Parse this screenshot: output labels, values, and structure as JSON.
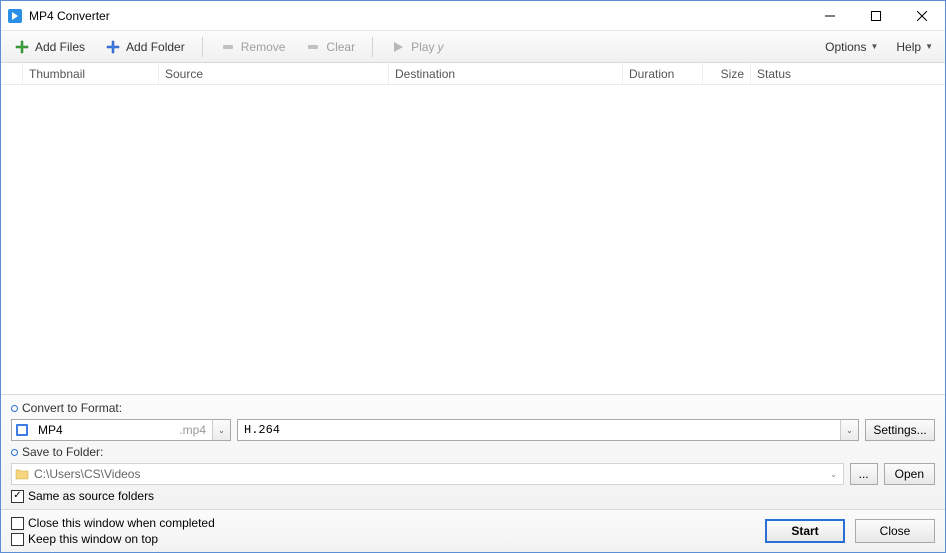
{
  "title": "MP4 Converter",
  "toolbar": {
    "add_files": "Add Files",
    "add_folder": "Add Folder",
    "remove": "Remove",
    "clear": "Clear",
    "play": "Play",
    "play_suffix": "y",
    "options": "Options",
    "help": "Help"
  },
  "columns": {
    "thumbnail": "Thumbnail",
    "source": "Source",
    "destination": "Destination",
    "duration": "Duration",
    "size": "Size",
    "status": "Status"
  },
  "convert": {
    "label": "Convert to Format:",
    "format": "MP4",
    "ext": ".mp4",
    "codec": "H.264",
    "settings": "Settings..."
  },
  "save": {
    "label": "Save to Folder:",
    "path": "C:\\Users\\CS\\Videos",
    "browse": "...",
    "open": "Open",
    "same_as_source": "Same as source folders"
  },
  "footer": {
    "close_when_completed": "Close this window when completed",
    "keep_on_top": "Keep this window on top",
    "start": "Start",
    "close": "Close"
  },
  "checkbox_state": {
    "same_as_source": true,
    "close_when_completed": false,
    "keep_on_top": false
  }
}
